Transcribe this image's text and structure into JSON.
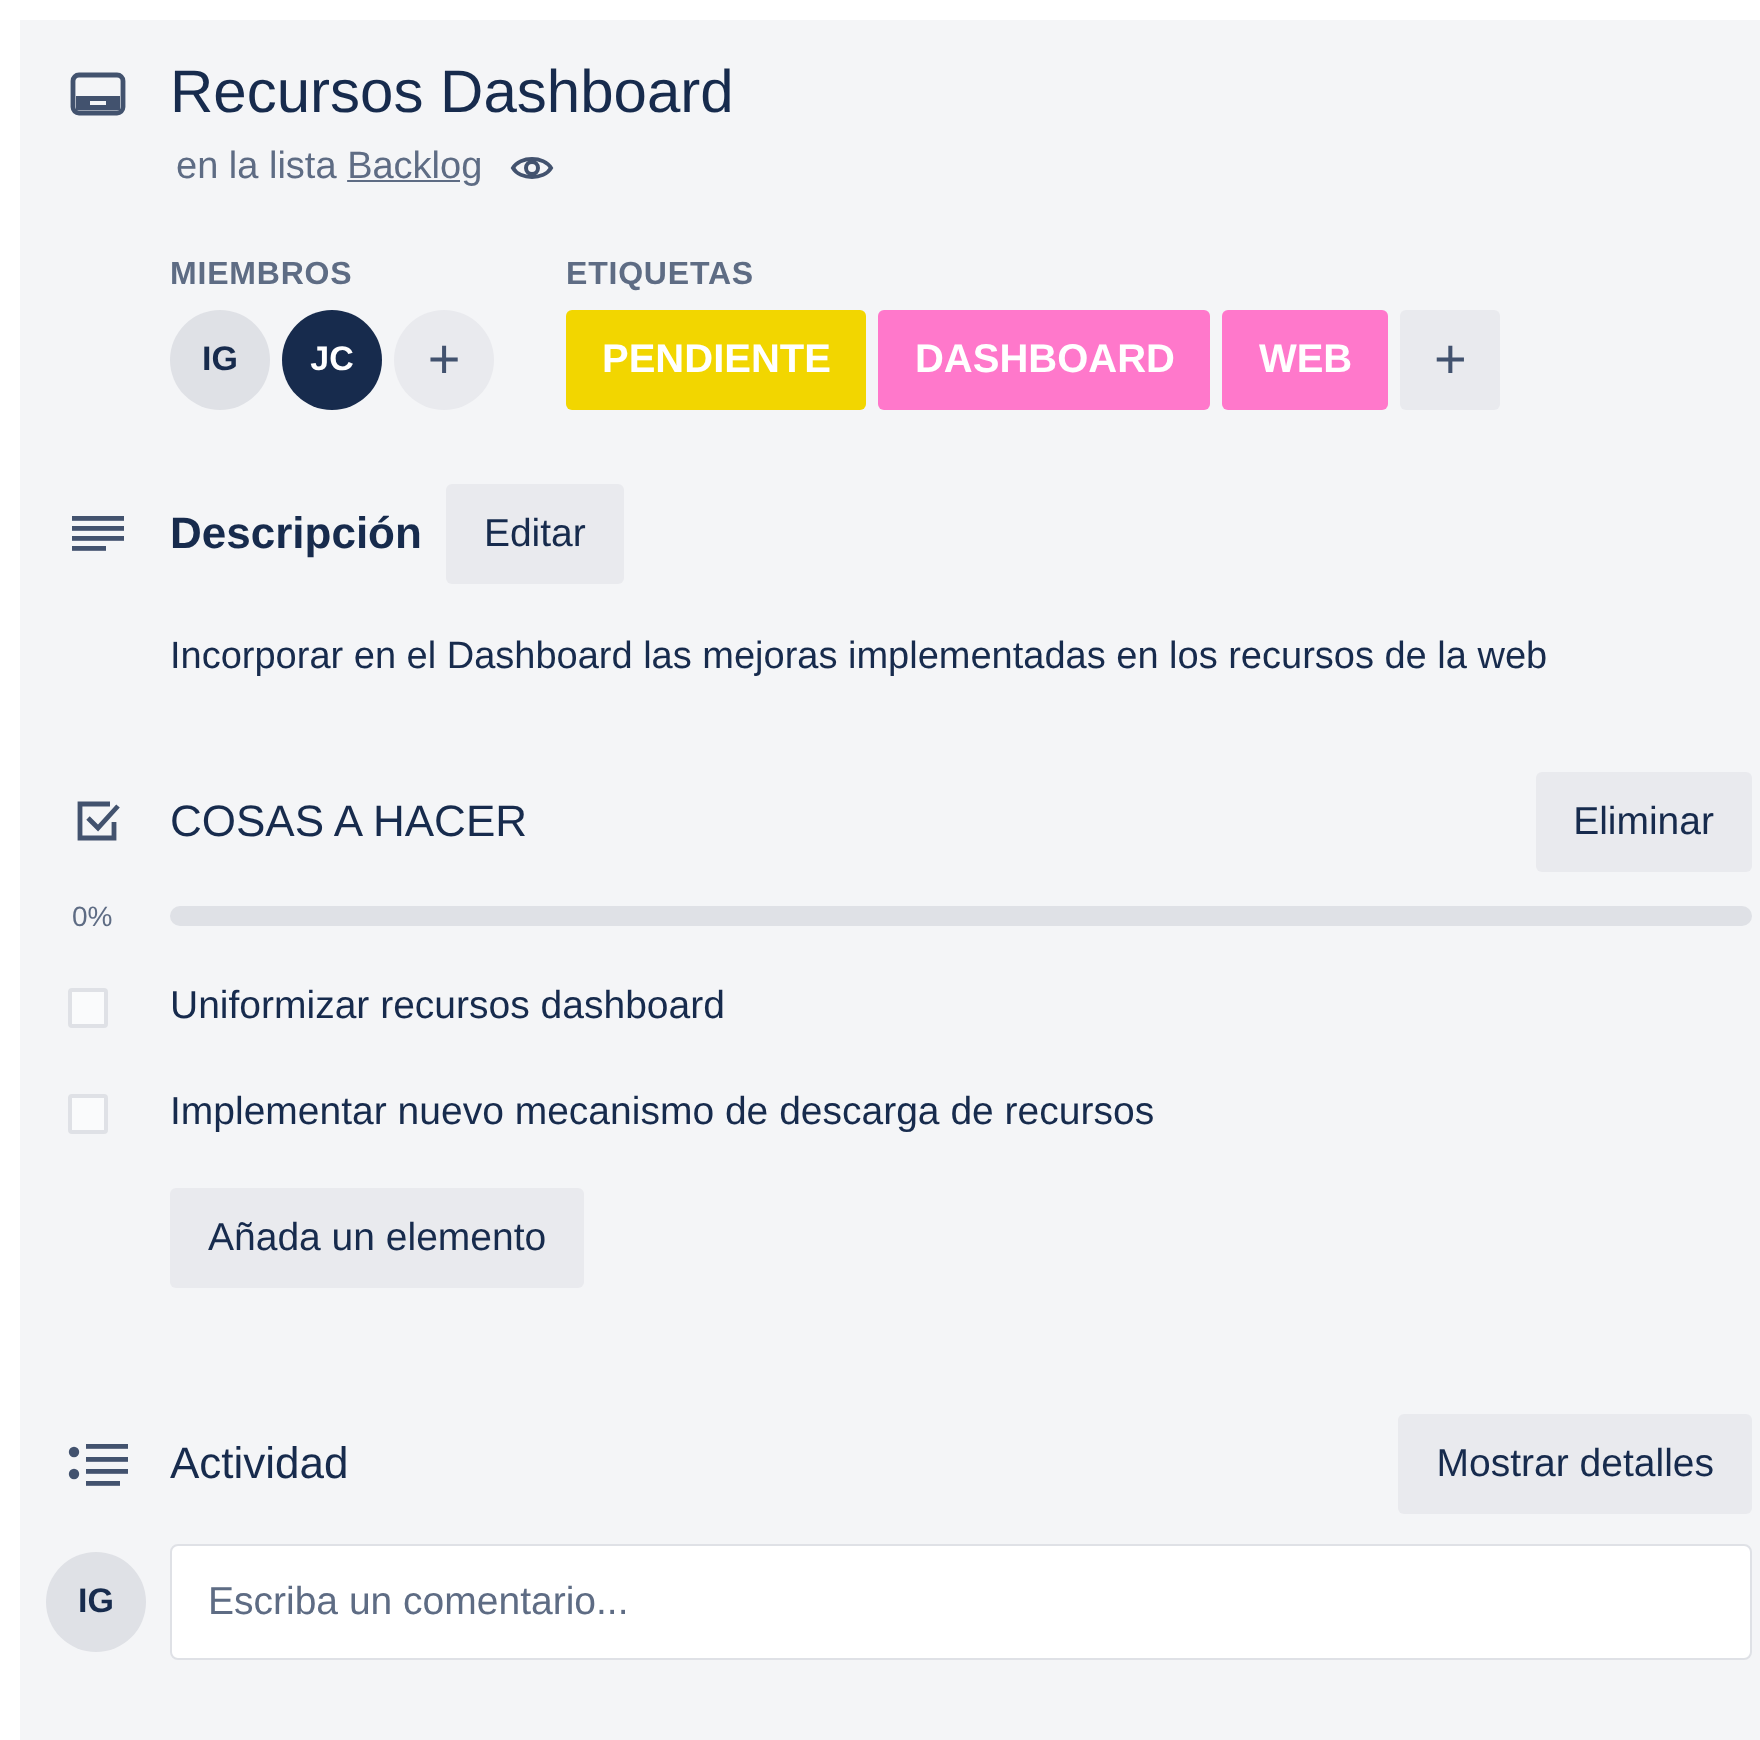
{
  "card": {
    "title": "Recursos Dashboard",
    "list_prefix": "en la lista",
    "list_name": "Backlog",
    "watching": true
  },
  "members": {
    "heading": "MIEMBROS",
    "avatars": [
      {
        "initials": "IG",
        "color": "#dfe1e6"
      },
      {
        "initials": "JC",
        "color": "#172b4d"
      }
    ],
    "add": "+"
  },
  "labels": {
    "heading": "ETIQUETAS",
    "items": [
      {
        "text": "PENDIENTE",
        "color": "#f2d600"
      },
      {
        "text": "DASHBOARD",
        "color": "#ff78cb"
      },
      {
        "text": "WEB",
        "color": "#ff78cb"
      }
    ],
    "add": "+"
  },
  "description": {
    "heading": "Descripción",
    "edit": "Editar",
    "text": "Incorporar en el Dashboard las mejoras implementadas en los recursos de la web"
  },
  "checklist": {
    "heading": "COSAS A HACER",
    "delete": "Eliminar",
    "percent": "0%",
    "level": 0,
    "items": [
      {
        "text": "Uniformizar recursos dashboard",
        "checked": false
      },
      {
        "text": "Implementar nuevo mecanismo de descarga de recursos",
        "checked": false
      }
    ],
    "add": "Añada un elemento"
  },
  "activity": {
    "heading": "Actividad",
    "details": "Mostrar detalles",
    "avatar": "IG",
    "placeholder": "Escriba un comentario..."
  }
}
